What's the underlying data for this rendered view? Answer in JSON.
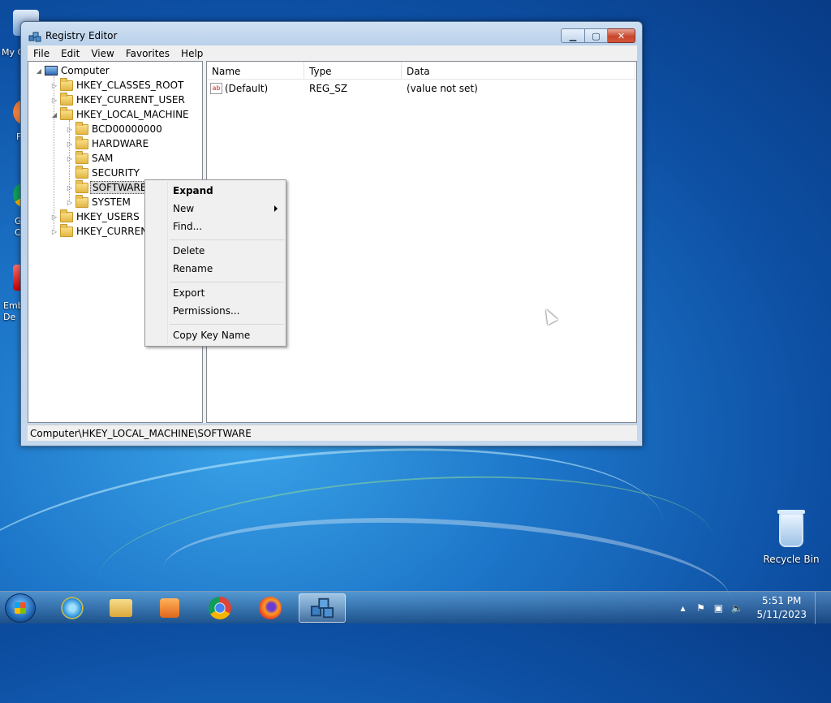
{
  "desktop": {
    "left_icons": [
      {
        "label": "My C"
      },
      {
        "label": "F"
      },
      {
        "label": "G\nC"
      },
      {
        "label": "Emb\nDe"
      }
    ],
    "recycle_bin": {
      "label": "Recycle Bin"
    }
  },
  "window": {
    "title": "Registry Editor",
    "menu": [
      "File",
      "Edit",
      "View",
      "Favorites",
      "Help"
    ],
    "tree": [
      {
        "label": "Computer",
        "level": 0,
        "expander": "◢",
        "icon": "computer-icon"
      },
      {
        "label": "HKEY_CLASSES_ROOT",
        "level": 1,
        "expander": "▷"
      },
      {
        "label": "HKEY_CURRENT_USER",
        "level": 1,
        "expander": "▷"
      },
      {
        "label": "HKEY_LOCAL_MACHINE",
        "level": 1,
        "expander": "◢"
      },
      {
        "label": "BCD00000000",
        "level": 2,
        "expander": "▷"
      },
      {
        "label": "HARDWARE",
        "level": 2,
        "expander": "▷"
      },
      {
        "label": "SAM",
        "level": 2,
        "expander": "▷"
      },
      {
        "label": "SECURITY",
        "level": 2,
        "expander": ""
      },
      {
        "label": "SOFTWARE",
        "level": 2,
        "expander": "▷",
        "selected": true
      },
      {
        "label": "SYSTEM",
        "level": 2,
        "expander": "▷"
      },
      {
        "label": "HKEY_USERS",
        "level": 1,
        "expander": "▷"
      },
      {
        "label": "HKEY_CURRENT",
        "level": 1,
        "expander": "▷"
      }
    ],
    "columns": [
      "Name",
      "Type",
      "Data"
    ],
    "values": [
      {
        "name": "(Default)",
        "type": "REG_SZ",
        "data": "(value not set)",
        "icon": "string-value-icon"
      }
    ],
    "status": "Computer\\HKEY_LOCAL_MACHINE\\SOFTWARE"
  },
  "context_menu": {
    "items": [
      {
        "label": "Expand",
        "bold": true
      },
      {
        "label": "New",
        "submenu": true
      },
      {
        "label": "Find..."
      },
      {
        "label": "Delete"
      },
      {
        "label": "Rename"
      },
      {
        "label": "Export"
      },
      {
        "label": "Permissions..."
      },
      {
        "label": "Copy Key Name"
      }
    ]
  },
  "taskbar": {
    "apps": [
      "internet-explorer",
      "file-explorer",
      "media-player",
      "chrome",
      "firefox",
      "registry-editor"
    ],
    "active_app": "registry-editor",
    "clock": {
      "time": "5:51 PM",
      "date": "5/11/2023"
    }
  },
  "colors": {
    "desktop_blue": "#1d76c9",
    "window_frame": "#c4d8ee",
    "close_red": "#c7482d",
    "selection_gray": "#d9d9d9"
  }
}
